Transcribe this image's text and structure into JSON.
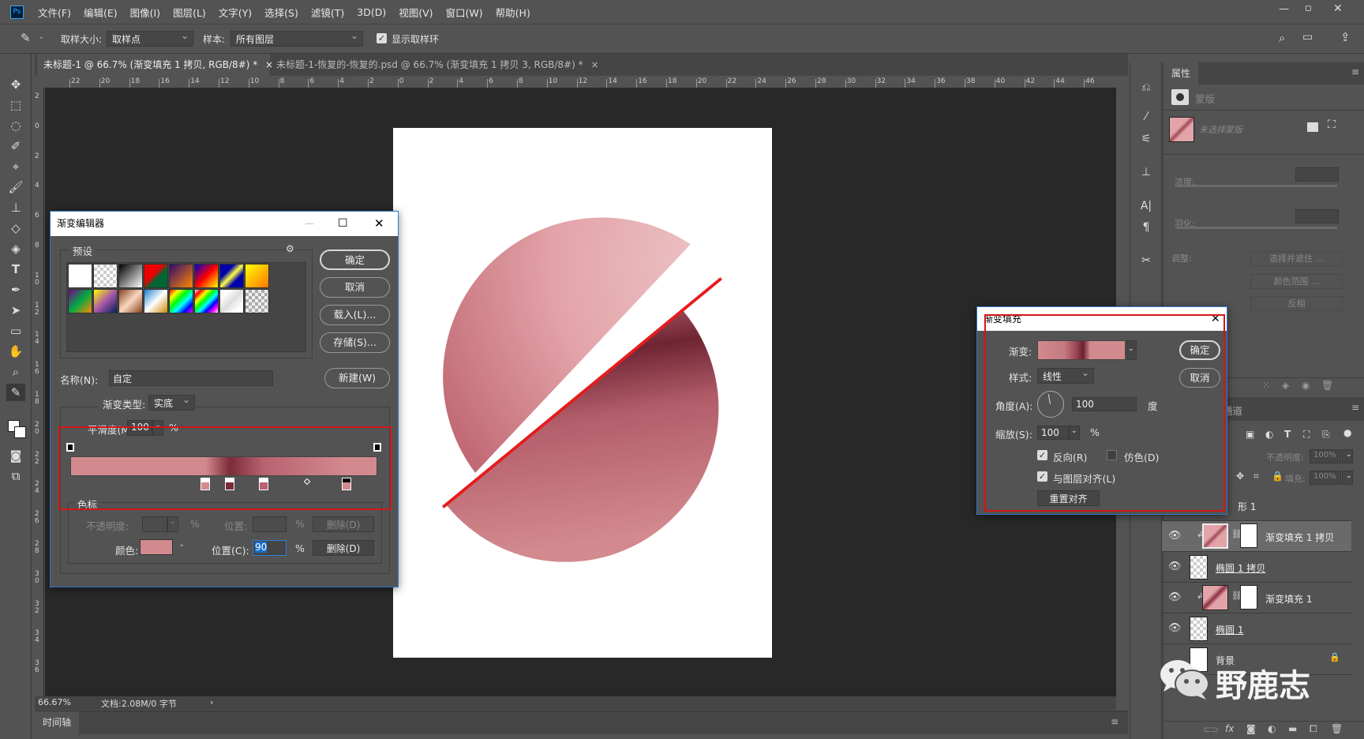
{
  "menu": {
    "app_icon": "Ps",
    "items": [
      "文件(F)",
      "编辑(E)",
      "图像(I)",
      "图层(L)",
      "文字(Y)",
      "选择(S)",
      "滤镜(T)",
      "3D(D)",
      "视图(V)",
      "窗口(W)",
      "帮助(H)"
    ]
  },
  "options": {
    "tool_icon": "eyedropper-icon",
    "sample_size_label": "取样大小:",
    "sample_size_value": "取样点",
    "sample_label": "样本:",
    "sample_value": "所有图层",
    "show_ring_label": "显示取样环",
    "show_ring_checked": true
  },
  "tabs": [
    {
      "label": "未标题-1 @ 66.7% (渐变填充 1 拷贝, RGB/8#) *",
      "close": "×",
      "active": true
    },
    {
      "label": "未标题-1-恢复的-恢复的.psd @ 66.7% (渐变填充 1 拷贝 3, RGB/8#) *",
      "close": "×",
      "active": false
    }
  ],
  "ruler": {
    "top": [
      "22",
      "20",
      "18",
      "16",
      "14",
      "12",
      "10",
      "8",
      "6",
      "4",
      "2",
      "0",
      "2",
      "4",
      "6",
      "8",
      "10",
      "12",
      "14",
      "16",
      "18",
      "20",
      "22",
      "24",
      "26",
      "28",
      "30",
      "32",
      "34",
      "36",
      "38",
      "40",
      "42",
      "44",
      "46"
    ],
    "left": [
      "2",
      "0",
      "2",
      "4",
      "6",
      "8",
      "10",
      "12",
      "14",
      "16",
      "18",
      "20",
      "22",
      "24",
      "26",
      "28",
      "30",
      "32",
      "34",
      "36"
    ]
  },
  "status": {
    "zoom": "66.67%",
    "doc": "文档:2.08M/0 字节",
    "arrow": "›"
  },
  "timeline": {
    "label": "时间轴"
  },
  "gradient_editor": {
    "title": "渐变编辑器",
    "presets_label": "预设",
    "ok": "确定",
    "cancel": "取消",
    "load": "载入(L)...",
    "save": "存储(S)...",
    "new": "新建(W)",
    "name_label": "名称(N):",
    "name_value": "自定",
    "type_label": "渐变类型:",
    "type_value": "实底",
    "smooth_label": "平滑度(M):",
    "smooth_value": "100",
    "smooth_unit": "%",
    "stops_group": "色标",
    "opacity_label": "不透明度:",
    "opacity_unit": "%",
    "opacity_pos_label": "位置:",
    "opacity_pos_unit": "%",
    "opacity_delete": "删除(D)",
    "color_label": "颜色:",
    "color_value": "#d28a8e",
    "color_pos_label": "位置(C):",
    "color_pos_value": "90",
    "color_pos_unit": "%",
    "color_delete": "删除(D)",
    "color_stops": [
      {
        "pos": 44,
        "color": "#d28a8e"
      },
      {
        "pos": 52,
        "color": "#7a2c38"
      },
      {
        "pos": 63,
        "color": "#b96270"
      },
      {
        "pos": 90,
        "color": "#d28a8e"
      }
    ],
    "midpoint": 77,
    "opacity_stops": [
      0,
      100
    ]
  },
  "gradient_fill": {
    "title": "渐变填充",
    "gradient_label": "渐变:",
    "style_label": "样式:",
    "style_value": "线性",
    "angle_label": "角度(A):",
    "angle_value": "100",
    "angle_unit": "度",
    "scale_label": "缩放(S):",
    "scale_value": "100",
    "scale_unit": "%",
    "reverse_label": "反向(R)",
    "reverse_checked": true,
    "dither_label": "仿色(D)",
    "dither_checked": false,
    "align_label": "与图层对齐(L)",
    "align_checked": true,
    "reset_label": "重置对齐",
    "ok": "确定",
    "cancel": "取消"
  },
  "properties": {
    "tab": "属性",
    "mask_label": "蒙版",
    "no_mask": "未选择蒙版",
    "density_label": "浓度:",
    "feather_label": "羽化:",
    "adjust_label": "调整:",
    "select_mask": "选择并遮住 ...",
    "color_range": "颜色范围 ...",
    "invert": "反相"
  },
  "layers": {
    "tab": "通道",
    "opacity_label": "不透明度:",
    "opacity_value": "100%",
    "fill_label": "填充:",
    "fill_value": "100%",
    "rows": [
      {
        "name": "形 1",
        "type": "partial"
      },
      {
        "name": "渐变填充 1 拷贝",
        "type": "fill",
        "selected": true
      },
      {
        "name": "椭圆 1 拷贝",
        "type": "shape"
      },
      {
        "name": "渐变填充 1",
        "type": "fill"
      },
      {
        "name": "椭圆 1",
        "type": "shape"
      },
      {
        "name": "背景",
        "type": "background",
        "locked": true
      }
    ]
  },
  "watermark": {
    "text": "野鹿志"
  },
  "colors": {
    "accent": "#d28a8e",
    "dark_band": "#7a2c38",
    "highlight": "#e51c1c",
    "ui_bg": "#535353",
    "canvas_bg": "#282828"
  }
}
